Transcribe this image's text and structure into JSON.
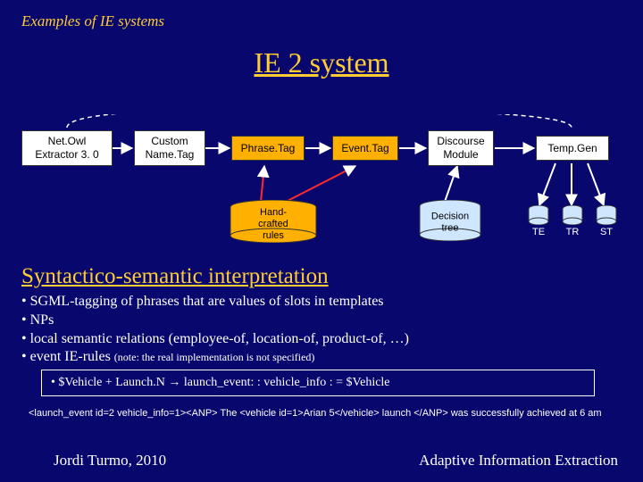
{
  "header": "Examples of IE systems",
  "title": "IE 2 system",
  "nodes": {
    "netowl": "Net.Owl\nExtractor 3. 0",
    "custom": "Custom\nName.Tag",
    "phrase": "Phrase.Tag",
    "event": "Event.Tag",
    "discourse": "Discourse\nModule",
    "tempgen": "Temp.Gen",
    "handrules": "Hand-crafted\nrules",
    "decisiontree": "Decision\ntree"
  },
  "sublabels": {
    "te": "TE",
    "tr": "TR",
    "st": "ST"
  },
  "subhead": "Syntactico-semantic interpretation",
  "bullets": [
    "SGML-tagging of phrases that are values of slots in templates",
    "NPs",
    "local semantic relations (employee-of, location-of, product-of, …)",
    "event IE-rules"
  ],
  "bullets_note": "(note: the real implementation is not specified)",
  "codebox": "$Vehicle + Launch.N → launch_event: : vehicle_info : = $Vehicle",
  "sgml": "<launch_event id=2 vehicle_info=1><ANP> The <vehicle id=1>Arian 5</vehicle> launch </ANP> was successfully achieved at 6 am",
  "footer_left": "Jordi Turmo, 2010",
  "footer_right": "Adaptive Information Extraction",
  "chart_data": {
    "type": "diagram",
    "title": "IE 2 system",
    "nodes": [
      {
        "id": "netowl",
        "label": "Net.Owl Extractor 3.0",
        "kind": "module"
      },
      {
        "id": "custom",
        "label": "Custom Name.Tag",
        "kind": "module"
      },
      {
        "id": "phrase",
        "label": "Phrase.Tag",
        "kind": "module",
        "highlighted": true
      },
      {
        "id": "event",
        "label": "Event.Tag",
        "kind": "module",
        "highlighted": true
      },
      {
        "id": "discourse",
        "label": "Discourse Module",
        "kind": "module"
      },
      {
        "id": "tempgen",
        "label": "Temp.Gen",
        "kind": "module"
      },
      {
        "id": "handrules",
        "label": "Hand-crafted rules",
        "kind": "datastore"
      },
      {
        "id": "decisiontree",
        "label": "Decision tree",
        "kind": "datastore"
      },
      {
        "id": "te",
        "label": "TE",
        "kind": "output"
      },
      {
        "id": "tr",
        "label": "TR",
        "kind": "output"
      },
      {
        "id": "st",
        "label": "ST",
        "kind": "output"
      }
    ],
    "edges": [
      {
        "from": "netowl",
        "to": "custom"
      },
      {
        "from": "custom",
        "to": "phrase"
      },
      {
        "from": "phrase",
        "to": "event"
      },
      {
        "from": "event",
        "to": "discourse"
      },
      {
        "from": "discourse",
        "to": "tempgen"
      },
      {
        "from": "handrules",
        "to": "phrase"
      },
      {
        "from": "handrules",
        "to": "event"
      },
      {
        "from": "decisiontree",
        "to": "discourse"
      },
      {
        "from": "tempgen",
        "to": "te"
      },
      {
        "from": "tempgen",
        "to": "tr"
      },
      {
        "from": "tempgen",
        "to": "st"
      }
    ]
  }
}
